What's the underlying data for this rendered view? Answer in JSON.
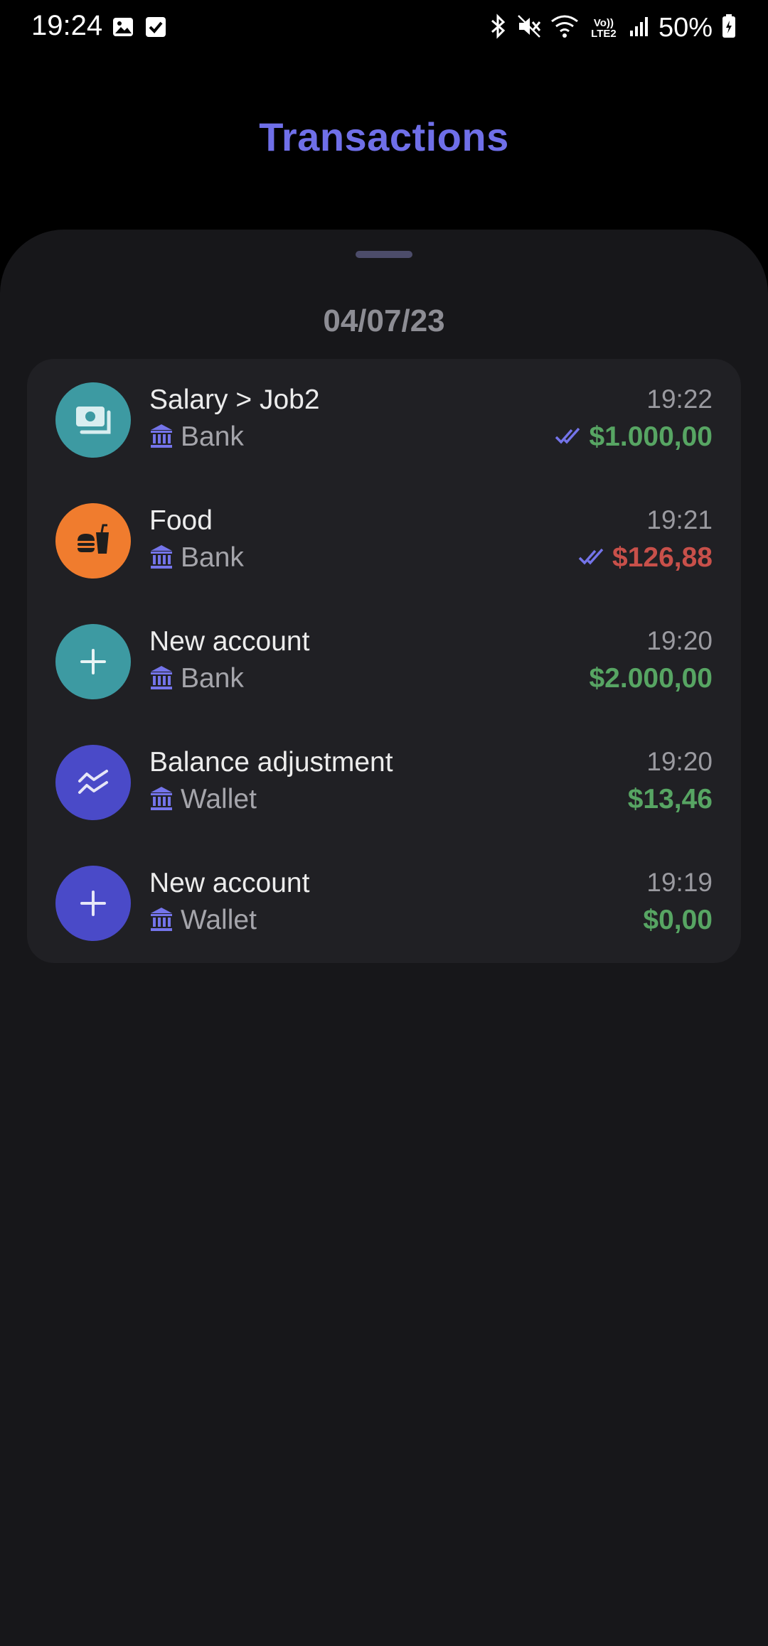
{
  "status_bar": {
    "time": "19:24",
    "left_icons": [
      "image-icon",
      "check-box-icon"
    ],
    "right_icons": [
      "bluetooth-icon",
      "mute-icon",
      "wifi-icon",
      "volte-icon",
      "signal-icon",
      "battery-icon"
    ],
    "volte_text": "Vo)) LTE2",
    "battery": "50%"
  },
  "header": {
    "title": "Transactions"
  },
  "sheet": {
    "date": "04/07/23",
    "transactions": [
      {
        "title": "Salary > Job2",
        "account": "Bank",
        "time": "19:22",
        "amount": "$1.000,00",
        "type": "income",
        "confirmed": true,
        "icon": "cash-icon",
        "icon_color": "#3d9aa2"
      },
      {
        "title": "Food",
        "account": "Bank",
        "time": "19:21",
        "amount": "$126,88",
        "type": "expense",
        "confirmed": true,
        "icon": "fastfood-icon",
        "icon_color": "#f07c2e"
      },
      {
        "title": "New account",
        "account": "Bank",
        "time": "19:20",
        "amount": "$2.000,00",
        "type": "income",
        "confirmed": false,
        "icon": "plus-icon",
        "icon_color": "#3d9aa2"
      },
      {
        "title": "Balance adjustment",
        "account": "Wallet",
        "time": "19:20",
        "amount": "$13,46",
        "type": "income",
        "confirmed": false,
        "icon": "adjustment-icon",
        "icon_color": "#4a4ac8"
      },
      {
        "title": "New account",
        "account": "Wallet",
        "time": "19:19",
        "amount": "$0,00",
        "type": "income",
        "confirmed": false,
        "icon": "plus-icon",
        "icon_color": "#4a4ac8"
      }
    ]
  },
  "colors": {
    "accent": "#6f6fe8",
    "income": "#57a563",
    "expense": "#c8504a",
    "bank_icon": "#7474ea"
  }
}
